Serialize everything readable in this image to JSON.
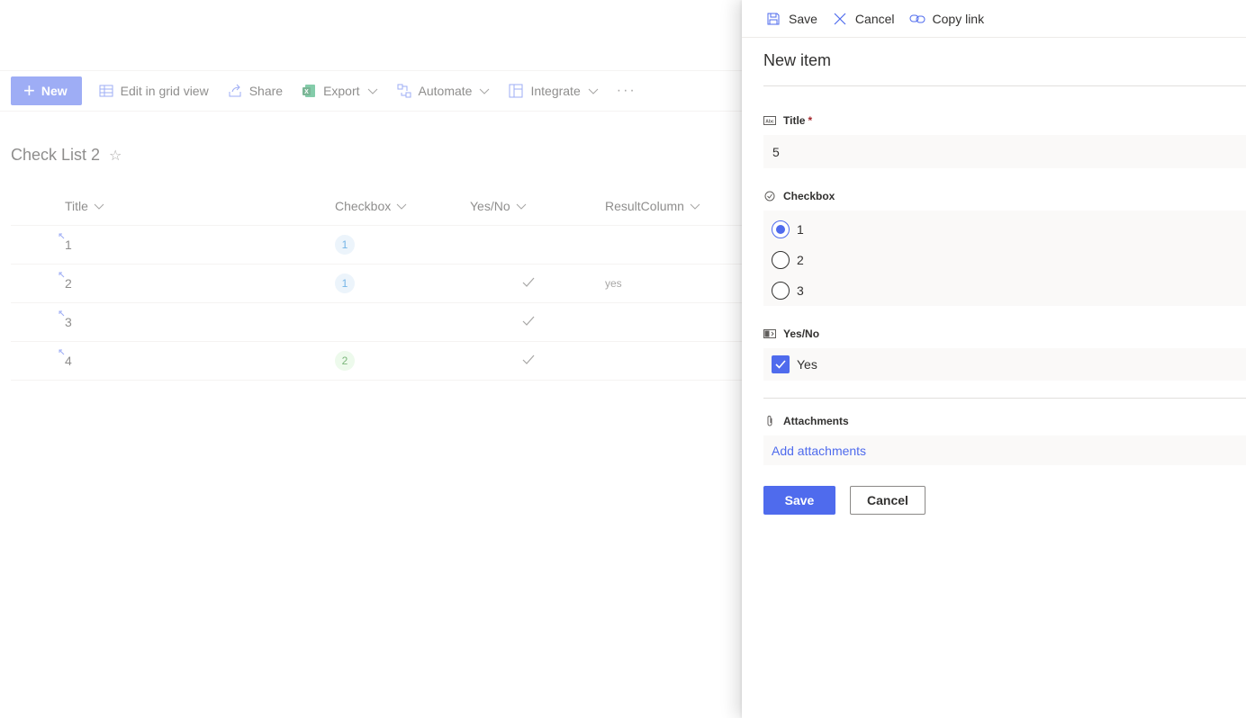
{
  "toolbar": {
    "new_label": "New",
    "edit_grid_label": "Edit in grid view",
    "share_label": "Share",
    "export_label": "Export",
    "automate_label": "Automate",
    "integrate_label": "Integrate",
    "more_label": "···"
  },
  "list": {
    "title": "Check List 2",
    "columns": [
      "Title",
      "Checkbox",
      "Yes/No",
      "ResultColumn"
    ],
    "rows": [
      {
        "title": "1",
        "checkbox": "1",
        "checkbox_color": "blue",
        "yesno": false,
        "result": ""
      },
      {
        "title": "2",
        "checkbox": "1",
        "checkbox_color": "blue",
        "yesno": true,
        "result": "yes"
      },
      {
        "title": "3",
        "checkbox": "",
        "checkbox_color": "",
        "yesno": true,
        "result": ""
      },
      {
        "title": "4",
        "checkbox": "2",
        "checkbox_color": "green",
        "yesno": true,
        "result": ""
      }
    ]
  },
  "panel": {
    "toolbar": {
      "save_label": "Save",
      "cancel_label": "Cancel",
      "copy_link_label": "Copy link"
    },
    "title": "New item",
    "fields": {
      "title_label": "Title",
      "title_required": "*",
      "title_value": "5",
      "checkbox_label": "Checkbox",
      "checkbox_options": [
        "1",
        "2",
        "3"
      ],
      "checkbox_selected": "1",
      "yesno_label": "Yes/No",
      "yesno_value_label": "Yes",
      "attachments_label": "Attachments",
      "add_attachments_label": "Add attachments"
    },
    "save_button": "Save",
    "cancel_button": "Cancel"
  },
  "colors": {
    "accent": "#4f6bed",
    "required": "#a4262c",
    "field_bg": "#faf9f8"
  }
}
